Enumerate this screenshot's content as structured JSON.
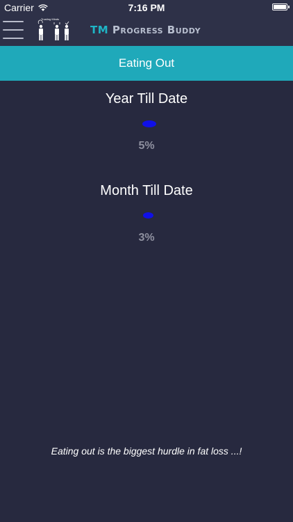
{
  "status_bar": {
    "carrier": "Carrier",
    "time": "7:16 PM"
  },
  "navbar": {
    "logo_text": "Trusting Minds",
    "title_prefix": "TM",
    "title_rest": "Progress Buddy",
    "colors": {
      "accent": "#1fb5c6",
      "title": "#b8bfcf"
    }
  },
  "section": {
    "title": "Eating Out"
  },
  "stats": [
    {
      "title": "Year Till Date",
      "percent": "5%"
    },
    {
      "title": "Month Till Date",
      "percent": "3%"
    }
  ],
  "footer": {
    "message": "Eating out is the biggest hurdle in fat loss ...!"
  },
  "colors": {
    "background": "#27293f",
    "bar": "#2e3148",
    "section": "#1fa9ba",
    "progress": "#1010e8",
    "percent_text": "#8e909f"
  }
}
